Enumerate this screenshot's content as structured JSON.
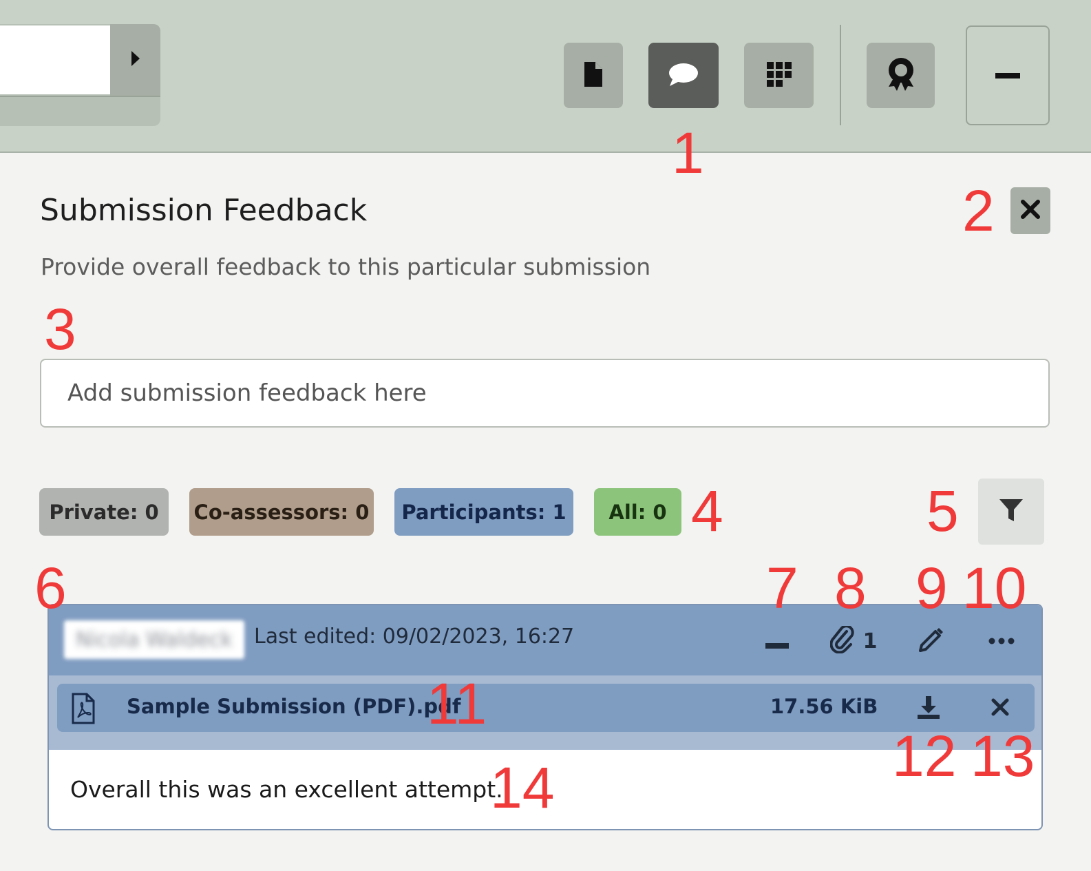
{
  "toolbar": {
    "buttons": [
      {
        "name": "document-view",
        "icon": "document-icon",
        "active": false
      },
      {
        "name": "feedback-view",
        "icon": "comment-icon",
        "active": true
      },
      {
        "name": "grid-view",
        "icon": "grid-icon",
        "active": false
      },
      {
        "name": "award-view",
        "icon": "award-icon",
        "active": false
      },
      {
        "name": "minimize",
        "icon": "minus-icon",
        "active": false
      }
    ],
    "nav_arrow_icon": "caret-right-icon"
  },
  "panel": {
    "title": "Submission Feedback",
    "subtitle": "Provide overall feedback to this particular submission",
    "close_icon": "close-icon",
    "feedback_input": {
      "value": "",
      "placeholder": "Add submission feedback here"
    }
  },
  "filters": [
    {
      "label": "Private: 0",
      "color": "#b0b3af",
      "text_color": "#2b2b2b"
    },
    {
      "label": "Co-assessors: 0",
      "color": "#b09d8b",
      "text_color": "#2a1f15"
    },
    {
      "label": "Participants: 1",
      "color": "#7f9cc1",
      "text_color": "#14264a"
    },
    {
      "label": "All: 0",
      "color": "#8cc47b",
      "text_color": "#17330f"
    }
  ],
  "filter_button_icon": "filter-icon",
  "comment": {
    "author": "Nicola Waldeck",
    "last_edited": "Last edited: 09/02/2023, 16:27",
    "attachment_count": "1",
    "actions": [
      "collapse-icon",
      "paperclip-icon",
      "pencil-icon",
      "more-icon"
    ],
    "file": {
      "name": "Sample Submission (PDF).pdf",
      "size": "17.56 KiB",
      "icon": "pdf-file-icon"
    },
    "text": "Overall this was an excellent attempt."
  },
  "annotations": [
    "1",
    "2",
    "3",
    "4",
    "5",
    "6",
    "7",
    "8",
    "9",
    "10",
    "11",
    "12",
    "13",
    "14"
  ]
}
